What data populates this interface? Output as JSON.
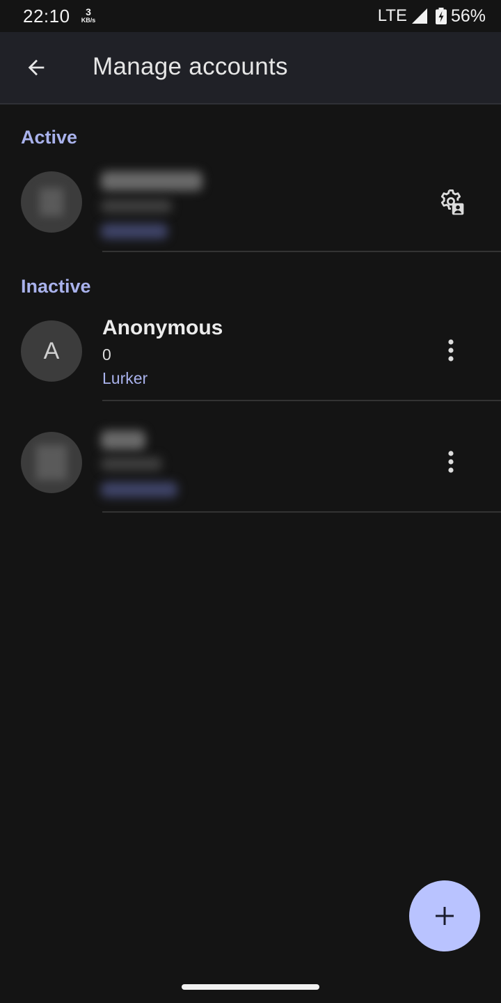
{
  "status_bar": {
    "time": "22:10",
    "net_speed_value": "3",
    "net_speed_unit": "KB/s",
    "network": "LTE",
    "battery": "56%"
  },
  "app_bar": {
    "title": "Manage accounts",
    "back_icon": "arrow-back-icon"
  },
  "sections": {
    "active_label": "Active",
    "inactive_label": "Inactive"
  },
  "accounts": {
    "active": {
      "avatar": "blurred-avatar",
      "settings_icon": "account-settings-icon"
    },
    "inactive": [
      {
        "avatar_letter": "A",
        "name": "Anonymous",
        "karma": "0",
        "role": "Lurker",
        "menu_icon": "more-vert-icon"
      },
      {
        "avatar": "blurred-avatar",
        "menu_icon": "more-vert-icon"
      }
    ]
  },
  "fab": {
    "icon": "add-icon"
  },
  "colors": {
    "accent": "#a9b2ec",
    "fab": "#b9c3ff",
    "background": "#141414",
    "app_bar": "#202127"
  }
}
